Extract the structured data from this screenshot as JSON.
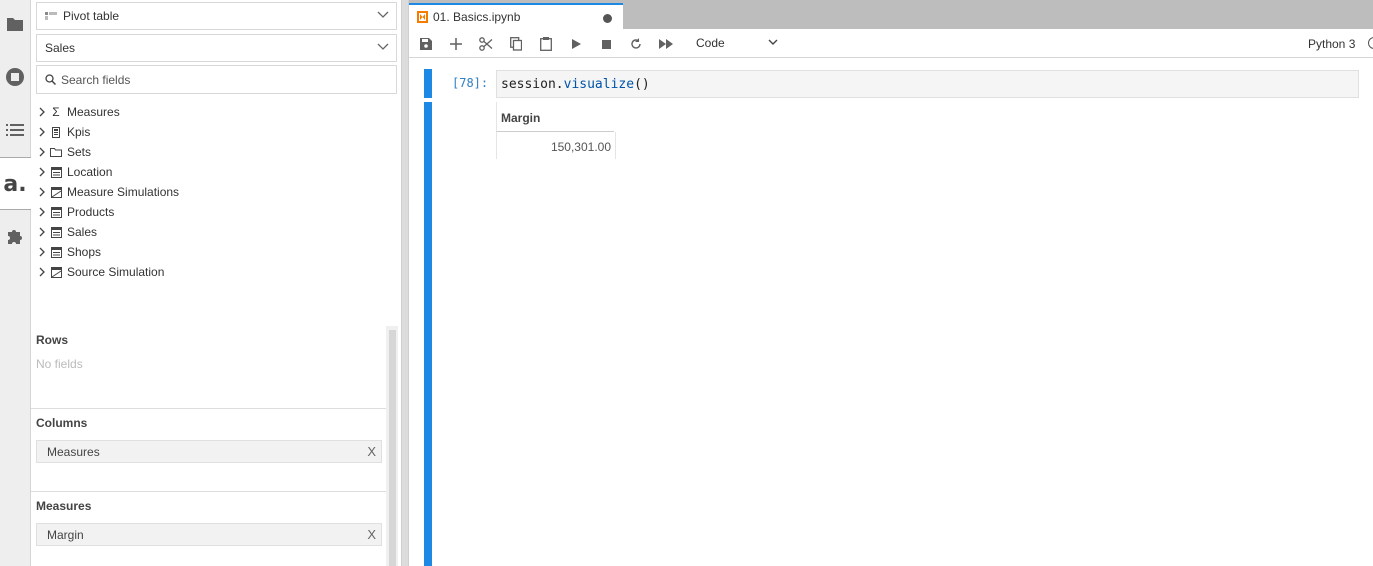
{
  "activity_bar": {
    "items": [
      {
        "name": "folder-icon"
      },
      {
        "name": "running-icon"
      },
      {
        "name": "toc-icon"
      },
      {
        "name": "atoti-icon",
        "label": "a."
      },
      {
        "name": "extension-icon"
      }
    ]
  },
  "left_panel": {
    "widget_dropdown": {
      "label": "Pivot table"
    },
    "cube_dropdown": {
      "label": "Sales"
    },
    "search": {
      "placeholder": "Search fields"
    },
    "tree": [
      {
        "label": "Measures",
        "icon": "sigma-icon"
      },
      {
        "label": "Kpis",
        "icon": "kpi-icon"
      },
      {
        "label": "Sets",
        "icon": "folder-icon"
      },
      {
        "label": "Location",
        "icon": "dimension-icon"
      },
      {
        "label": "Measure Simulations",
        "icon": "simulation-icon"
      },
      {
        "label": "Products",
        "icon": "dimension-icon"
      },
      {
        "label": "Sales",
        "icon": "dimension-icon"
      },
      {
        "label": "Shops",
        "icon": "dimension-icon"
      },
      {
        "label": "Source Simulation",
        "icon": "simulation-icon"
      }
    ],
    "rows": {
      "title": "Rows",
      "empty_text": "No fields"
    },
    "columns": {
      "title": "Columns",
      "chips": [
        "Measures"
      ]
    },
    "measures": {
      "title": "Measures",
      "chips": [
        "Margin"
      ]
    },
    "chip_remove": "X"
  },
  "tab": {
    "label": "01. Basics.ipynb"
  },
  "toolbar": {
    "cell_type": "Code",
    "kernel": "Python 3"
  },
  "cell": {
    "prompt": "[78]:",
    "code_obj": "session.",
    "code_fn": "visualize",
    "code_args": "()"
  },
  "output": {
    "header": "Margin",
    "value": "150,301.00"
  }
}
